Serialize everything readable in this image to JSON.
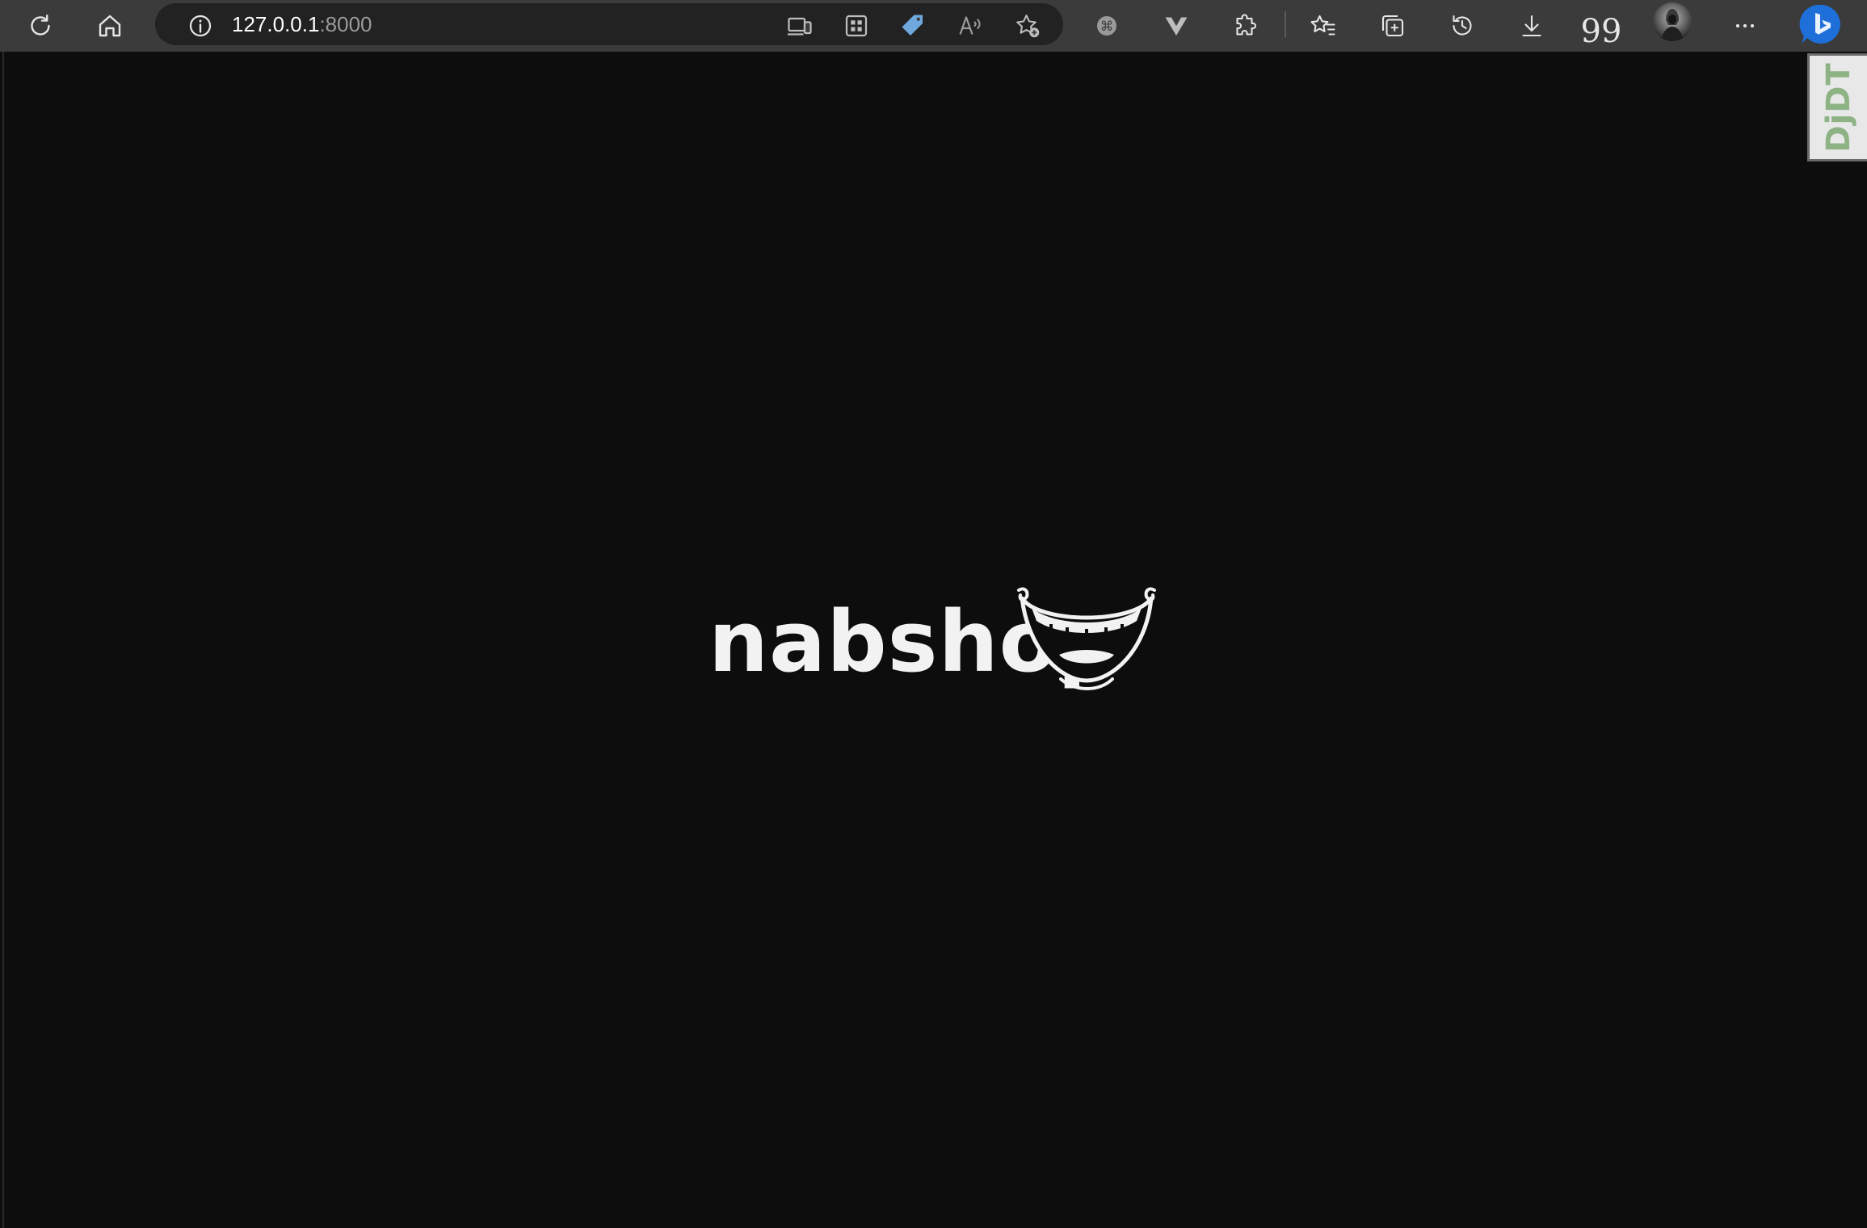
{
  "browser": {
    "url_host": "127.0.0.1",
    "url_port": ":8000",
    "toolbar_buttons": [
      {
        "name": "refresh",
        "icon": "refresh-icon"
      },
      {
        "name": "home",
        "icon": "home-icon"
      },
      {
        "name": "site-info",
        "icon": "info-icon"
      },
      {
        "name": "device-emulation",
        "icon": "device-icon"
      },
      {
        "name": "apps",
        "icon": "apps-icon"
      },
      {
        "name": "shopping",
        "icon": "tag-icon"
      },
      {
        "name": "read-aloud",
        "icon": "read-aloud-icon"
      },
      {
        "name": "add-favorite",
        "icon": "star-add-icon"
      },
      {
        "name": "extension-shortcut",
        "icon": "command-icon"
      },
      {
        "name": "vue-devtools",
        "icon": "vue-icon"
      },
      {
        "name": "extensions",
        "icon": "puzzle-icon"
      },
      {
        "name": "favorites",
        "icon": "favorites-icon"
      },
      {
        "name": "collections",
        "icon": "collections-icon"
      },
      {
        "name": "history",
        "icon": "history-icon"
      },
      {
        "name": "downloads",
        "icon": "download-icon"
      },
      {
        "name": "citation",
        "icon": "quote-icon",
        "label": "99"
      },
      {
        "name": "profile",
        "icon": "avatar-icon"
      },
      {
        "name": "more",
        "icon": "more-icon"
      },
      {
        "name": "bing",
        "icon": "bing-icon"
      }
    ],
    "accent_bing": "#1e6fd9",
    "accent_tag": "#6fa8dc"
  },
  "page": {
    "background": "#0d0d0d",
    "logo_text": "nabshop",
    "logo_icon": "smiling-mouth-icon"
  },
  "debug_toolbar": {
    "label": "DjDT",
    "color": "#8db384"
  }
}
